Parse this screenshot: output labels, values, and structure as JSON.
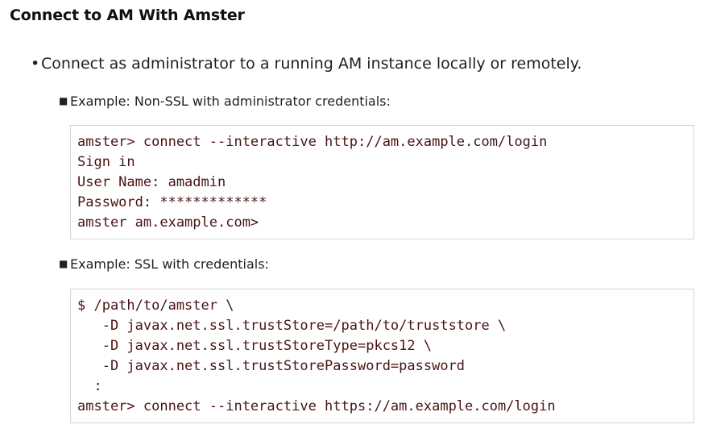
{
  "title": "Connect to AM With Amster",
  "main_bullet": "Connect as administrator to a running AM instance locally or remotely.",
  "examples": [
    {
      "label": "Example: Non-SSL with administrator credentials:",
      "code": [
        "amster> connect --interactive http://am.example.com/login",
        "Sign in",
        "User Name: amadmin",
        "Password: *************",
        "amster am.example.com>"
      ]
    },
    {
      "label": "Example: SSL with credentials:",
      "code": [
        "$ /path/to/amster \\",
        "   -D javax.net.ssl.trustStore=/path/to/truststore \\",
        "   -D javax.net.ssl.trustStoreType=pkcs12 \\",
        "   -D javax.net.ssl.trustStorePassword=password",
        "  :",
        "amster> connect --interactive https://am.example.com/login"
      ]
    }
  ]
}
